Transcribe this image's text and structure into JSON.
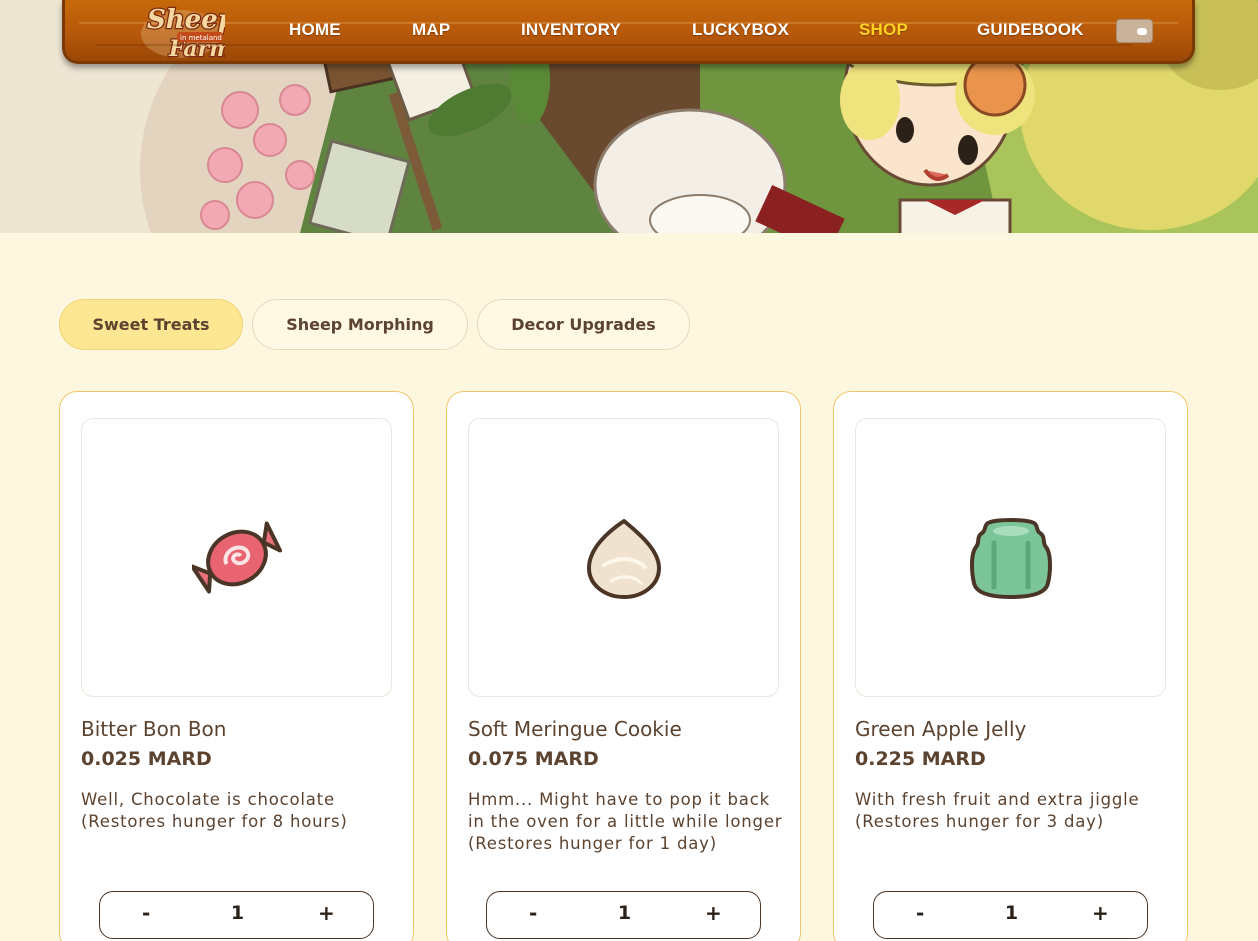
{
  "nav": {
    "logo_text": "Sheep Farm in metaland",
    "items": [
      {
        "label": "HOME",
        "active": false
      },
      {
        "label": "MAP",
        "active": false
      },
      {
        "label": "INVENTORY",
        "active": false
      },
      {
        "label": "LUCKYBOX",
        "active": false
      },
      {
        "label": "SHOP",
        "active": true
      },
      {
        "label": "GUIDEBOOK",
        "active": false
      }
    ],
    "wallet_icon": "wallet-icon",
    "active_color": "#ffd21f"
  },
  "tabs": [
    {
      "label": "Sweet Treats",
      "active": true
    },
    {
      "label": "Sheep Morphing",
      "active": false
    },
    {
      "label": "Decor Upgrades",
      "active": false
    }
  ],
  "products": [
    {
      "name": "Bitter Bon Bon",
      "price": "0.025 MARD",
      "description": "Well, Chocolate is chocolate\n(Restores hunger for 8 hours)",
      "icon": "candy-icon",
      "quantity": "1",
      "minus": "-",
      "plus": "+"
    },
    {
      "name": "Soft Meringue Cookie",
      "price": "0.075 MARD",
      "description": "Hmm... Might have to pop it back in the oven for a little while longer\n(Restores hunger for 1 day)",
      "icon": "meringue-icon",
      "quantity": "1",
      "minus": "-",
      "plus": "+"
    },
    {
      "name": "Green Apple Jelly",
      "price": "0.225 MARD",
      "description": "With fresh fruit and extra jiggle\n(Restores hunger for 3 day)",
      "icon": "jelly-icon",
      "quantity": "1",
      "minus": "-",
      "plus": "+"
    }
  ]
}
